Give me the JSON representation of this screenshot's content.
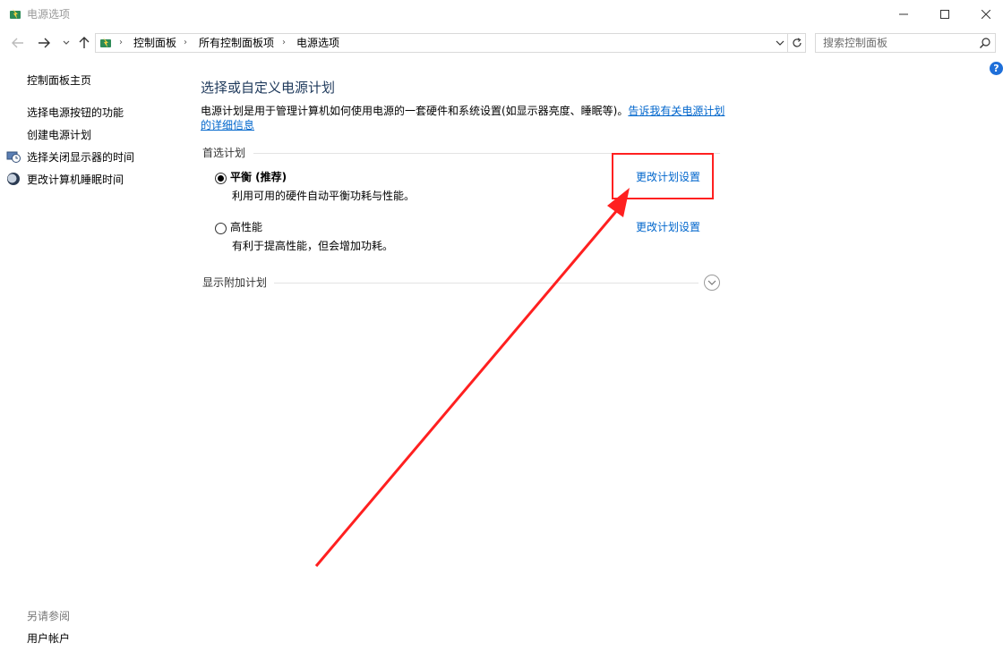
{
  "window": {
    "title": "电源选项",
    "minimize_icon": "minimize-icon",
    "maximize_icon": "maximize-icon",
    "close_icon": "close-icon"
  },
  "navigation": {
    "breadcrumbs": [
      "控制面板",
      "所有控制面板项",
      "电源选项"
    ],
    "search_placeholder": "搜索控制面板"
  },
  "sidebar": {
    "home": "控制面板主页",
    "links": [
      {
        "label": "选择电源按钮的功能",
        "icon": null
      },
      {
        "label": "创建电源计划",
        "icon": null
      },
      {
        "label": "选择关闭显示器的时间",
        "icon": "monitor-clock-icon"
      },
      {
        "label": "更改计算机睡眠时间",
        "icon": "moon-icon"
      }
    ],
    "see_also_heading": "另请参阅",
    "see_also_links": [
      "用户帐户"
    ]
  },
  "main": {
    "title": "选择或自定义电源计划",
    "description": "电源计划是用于管理计算机如何使用电源的一套硬件和系统设置(如显示器亮度、睡眠等)。",
    "description_link": "告诉我有关电源计划的详细信息",
    "preferred_plans_label": "首选计划",
    "plans": [
      {
        "name": "平衡 (推荐)",
        "description": "利用可用的硬件自动平衡功耗与性能。",
        "selected": true,
        "link": "更改计划设置"
      },
      {
        "name": "高性能",
        "description": "有利于提高性能，但会增加功耗。",
        "selected": false,
        "link": "更改计划设置"
      }
    ],
    "show_additional_label": "显示附加计划"
  },
  "annotation": {
    "highlight_color": "#ff2020"
  }
}
